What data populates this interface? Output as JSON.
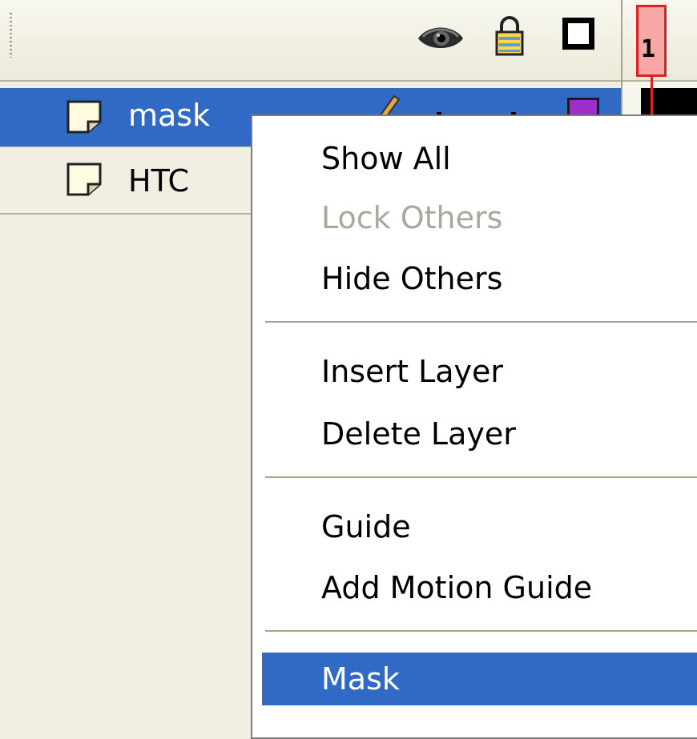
{
  "timeline": {
    "frame_label": "1",
    "header_icons": [
      "show-hide-eye-icon",
      "lock-icon",
      "outline-icon"
    ]
  },
  "layers": [
    {
      "name": "mask",
      "selected": true,
      "icon": "layer-page-icon",
      "color": "#9c2fc7"
    },
    {
      "name": "HTC",
      "selected": false,
      "icon": "layer-page-icon"
    }
  ],
  "menu": {
    "items": [
      {
        "label": "Show All",
        "disabled": false
      },
      {
        "label": "Lock Others",
        "disabled": true
      },
      {
        "label": "Hide Others",
        "disabled": false
      },
      {
        "label": "Insert Layer",
        "disabled": false
      },
      {
        "label": "Delete Layer",
        "disabled": false
      },
      {
        "label": "Guide",
        "disabled": false
      },
      {
        "label": "Add Motion Guide",
        "disabled": false
      },
      {
        "label": "Mask",
        "disabled": false,
        "highlighted": true
      }
    ]
  },
  "colors": {
    "selection": "#316ac5",
    "panel_bg": "#f1efe2",
    "playhead": "#dd2222",
    "layer_swatch": "#9c2fc7"
  }
}
